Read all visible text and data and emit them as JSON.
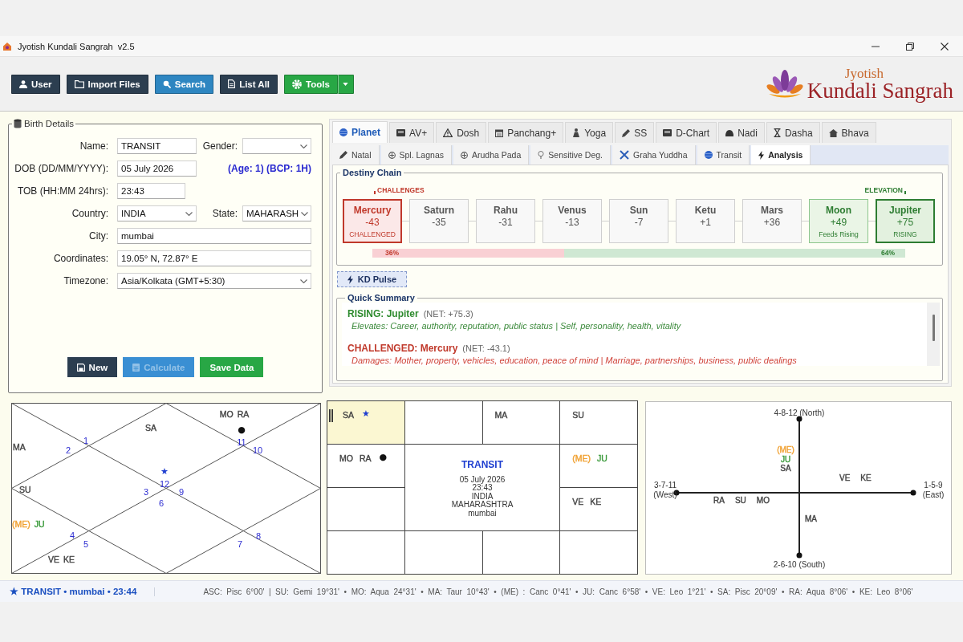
{
  "window": {
    "title": "Jyotish Kundali Sangrah  v2.5"
  },
  "toolbar": {
    "buttons": [
      {
        "label": "User",
        "kind": "button",
        "color": "#2c3e50"
      },
      {
        "label": "Import Files",
        "kind": "button",
        "color": "#2c3e50"
      },
      {
        "label": "Search",
        "kind": "button",
        "color": "#2e86c1"
      },
      {
        "label": "List All",
        "kind": "button",
        "color": "#2c3e50"
      },
      {
        "label": "Tools",
        "kind": "split",
        "color": "#28a745"
      }
    ],
    "logo": {
      "small_text": "Jyotish",
      "large_text": "Kundali Sangrah"
    }
  },
  "birth_details": {
    "legend": "Birth Details",
    "rows": [
      {
        "fields": [
          {
            "label": "Name:",
            "kind": "text",
            "value": "TRANSIT"
          },
          {
            "label": "Gender:",
            "kind": "dropdown"
          }
        ]
      },
      {
        "fields": [
          {
            "label": "DOB (DD/MM/YYYY):",
            "kind": "text",
            "value": "05 July 2026"
          }
        ],
        "note": "(Age: 1) (BCP: 1H)"
      },
      {
        "fields": [
          {
            "label": "TOB (HH:MM 24hrs):",
            "kind": "text",
            "value": "23:43"
          }
        ]
      },
      {
        "fields": [
          {
            "label": "Country:",
            "kind": "dropdown",
            "value": "INDIA"
          },
          {
            "label": "State:",
            "kind": "dropdown",
            "value": "MAHARASH"
          }
        ]
      },
      {
        "fields": [
          {
            "label": "City:",
            "kind": "text",
            "value": "mumbai"
          }
        ]
      },
      {
        "fields": [
          {
            "label": "Coordinates:",
            "kind": "text",
            "value": "19.05° N, 72.87° E"
          }
        ]
      },
      {
        "fields": [
          {
            "label": "Timezone:",
            "kind": "dropdown",
            "value": "Asia/Kolkata (GMT+5:30)"
          }
        ]
      }
    ],
    "buttons": [
      {
        "label": "New",
        "color": "#2c3e50",
        "disabled": false
      },
      {
        "label": "Calculate",
        "color": "#3a8fd3",
        "disabled": true
      },
      {
        "label": "Save Data",
        "color": "#28a745",
        "disabled": false
      }
    ]
  },
  "analysis_panel": {
    "tabs": [
      {
        "label": "Planet",
        "selected": true
      },
      {
        "label": "AV+",
        "selected": false
      },
      {
        "label": "Dosh",
        "selected": false
      },
      {
        "label": "Panchang+",
        "selected": false
      },
      {
        "label": "Yoga",
        "selected": false
      },
      {
        "label": "SS",
        "selected": false
      },
      {
        "label": "D-Chart",
        "selected": false
      },
      {
        "label": "Nadi",
        "selected": false
      },
      {
        "label": "Dasha",
        "selected": false
      },
      {
        "label": "Bhava",
        "selected": false
      }
    ],
    "sub_tabs": [
      {
        "label": "Natal",
        "selected": false
      },
      {
        "label": "Spl. Lagnas",
        "selected": false
      },
      {
        "label": "Arudha Pada",
        "selected": false
      },
      {
        "label": "Sensitive Deg.",
        "selected": false
      },
      {
        "label": "Graha Yuddha",
        "selected": false
      },
      {
        "label": "Transit",
        "selected": false
      },
      {
        "label": "Analysis",
        "selected": true
      }
    ],
    "destiny_chain": {
      "legend": "Destiny Chain",
      "left_label": "CHALLENGES",
      "right_label": "ELEVATION",
      "planets": [
        {
          "name": "Mercury",
          "score": "-43",
          "tag": "CHALLENGED",
          "kind": "challenged"
        },
        {
          "name": "Saturn",
          "score": "-35",
          "kind": "neutral"
        },
        {
          "name": "Rahu",
          "score": "-31",
          "kind": "neutral"
        },
        {
          "name": "Venus",
          "score": "-13",
          "kind": "neutral"
        },
        {
          "name": "Sun",
          "score": "-7",
          "kind": "neutral"
        },
        {
          "name": "Ketu",
          "score": "+1",
          "kind": "neutral"
        },
        {
          "name": "Mars",
          "score": "+36",
          "kind": "neutral"
        },
        {
          "name": "Moon",
          "score": "+49",
          "tag": "Feeds Rising",
          "kind": "supporting"
        },
        {
          "name": "Jupiter",
          "score": "+75",
          "tag": "RISING",
          "kind": "rising"
        }
      ],
      "balance": {
        "level": 0.36,
        "left_reading": "36%",
        "right_reading": "64%"
      }
    },
    "pulse_button": {
      "label": "KD Pulse"
    },
    "quick_summary": {
      "legend": "Quick Summary",
      "entries": [
        {
          "kind": "rising",
          "heading": "RISING: Jupiter",
          "net": "(NET: +75.3)",
          "detail": "Elevates: Career, authority, reputation, public status | Self, personality, health, vitality"
        },
        {
          "kind": "challenged",
          "heading": "CHALLENGED: Mercury",
          "net": "(NET: -43.1)",
          "detail": "Damages: Mother, property, vehicles, education, peace of mind | Marriage, partnerships, business, public dealings"
        }
      ]
    }
  },
  "north_chart": {
    "houses": [
      {
        "sign": "12",
        "planets": [
          {
            "label": "SA",
            "color": "#444444"
          }
        ],
        "marker": {
          "symbol": "★",
          "color": "#1f3fd0"
        }
      },
      {
        "sign": "1"
      },
      {
        "sign": "2",
        "planets": [
          {
            "label": "MA",
            "color": "#444444"
          }
        ]
      },
      {
        "sign": "3",
        "planets": [
          {
            "label": "SU",
            "color": "#444444"
          }
        ]
      },
      {
        "sign": "4",
        "planets": [
          {
            "label": "(ME)",
            "color": "#f0a030"
          },
          {
            "label": "JU",
            "color": "#3a9a3a"
          }
        ]
      },
      {
        "sign": "5",
        "planets": [
          {
            "label": "VE",
            "color": "#444444"
          },
          {
            "label": "KE",
            "color": "#444444"
          }
        ]
      },
      {
        "sign": "6"
      },
      {
        "sign": "7"
      },
      {
        "sign": "8"
      },
      {
        "sign": "9"
      },
      {
        "sign": "10"
      },
      {
        "sign": "11",
        "planets": [
          {
            "label": "MO",
            "color": "#444444"
          },
          {
            "label": "RA",
            "color": "#444444"
          }
        ],
        "marker": {
          "symbol": "●",
          "color": "#111111"
        }
      }
    ]
  },
  "south_chart": {
    "center": {
      "title": "TRANSIT",
      "lines": [
        "05 July 2026",
        "23:43",
        "INDIA",
        "MAHARASHTRA",
        "mumbai"
      ]
    },
    "cells": [
      {
        "highlighted": true,
        "planets": [
          {
            "label": "SA",
            "color": "#444444"
          }
        ],
        "marker": {
          "symbol": "★",
          "color": "#1f3fd0"
        }
      },
      {
        "highlighted": false
      },
      {
        "highlighted": false,
        "planets": [
          {
            "label": "MA",
            "color": "#444444"
          }
        ]
      },
      {
        "highlighted": false,
        "planets": [
          {
            "label": "SU",
            "color": "#444444"
          }
        ]
      },
      {
        "highlighted": false,
        "planets": [
          {
            "label": "MO",
            "color": "#444444"
          },
          {
            "label": "RA",
            "color": "#444444"
          }
        ],
        "marker": {
          "symbol": "●",
          "color": "#111111"
        }
      },
      {
        "highlighted": false,
        "planets": [
          {
            "label": "(ME)",
            "color": "#f0a030"
          },
          {
            "label": "JU",
            "color": "#3a9a3a"
          }
        ]
      },
      {
        "highlighted": false
      },
      {
        "highlighted": false,
        "planets": [
          {
            "label": "VE",
            "color": "#444444"
          },
          {
            "label": "KE",
            "color": "#444444"
          }
        ]
      },
      {
        "highlighted": false
      },
      {
        "highlighted": false
      },
      {
        "highlighted": false
      },
      {
        "highlighted": false
      }
    ]
  },
  "cross_chart": {
    "arms": [
      {
        "group": "4-8-12",
        "direction": "(North)",
        "planets": [
          {
            "label": "(ME)",
            "color": "#f0a030"
          },
          {
            "label": "JU",
            "color": "#3a9a3a"
          },
          {
            "label": "SA",
            "color": "#444444"
          }
        ]
      },
      {
        "group": "3-7-11",
        "direction": "(West)",
        "planets": [
          {
            "label": "RA",
            "color": "#444444"
          },
          {
            "label": "SU",
            "color": "#444444"
          },
          {
            "label": "MO",
            "color": "#444444"
          }
        ]
      },
      {
        "group": "1-5-9",
        "direction": "(East)",
        "planets": [
          {
            "label": "VE",
            "color": "#444444"
          },
          {
            "label": "KE",
            "color": "#444444"
          }
        ]
      },
      {
        "group": "2-6-10",
        "direction": "(South)",
        "planets": [
          {
            "label": "MA",
            "color": "#444444"
          }
        ]
      }
    ]
  },
  "status_bar": {
    "session": "★ TRANSIT • mumbai • 23:44",
    "positions": "ASC: Pisc 6°00' | SU: Gemi 19°31' • MO: Aqua 24°31' • MA: Taur 10°43' • (ME) : Canc 0°41' • JU: Canc 6°58' • VE: Leo 1°21' • SA: Pisc 20°09' • RA: Aqua 8°06' • KE: Leo 8°06'"
  }
}
